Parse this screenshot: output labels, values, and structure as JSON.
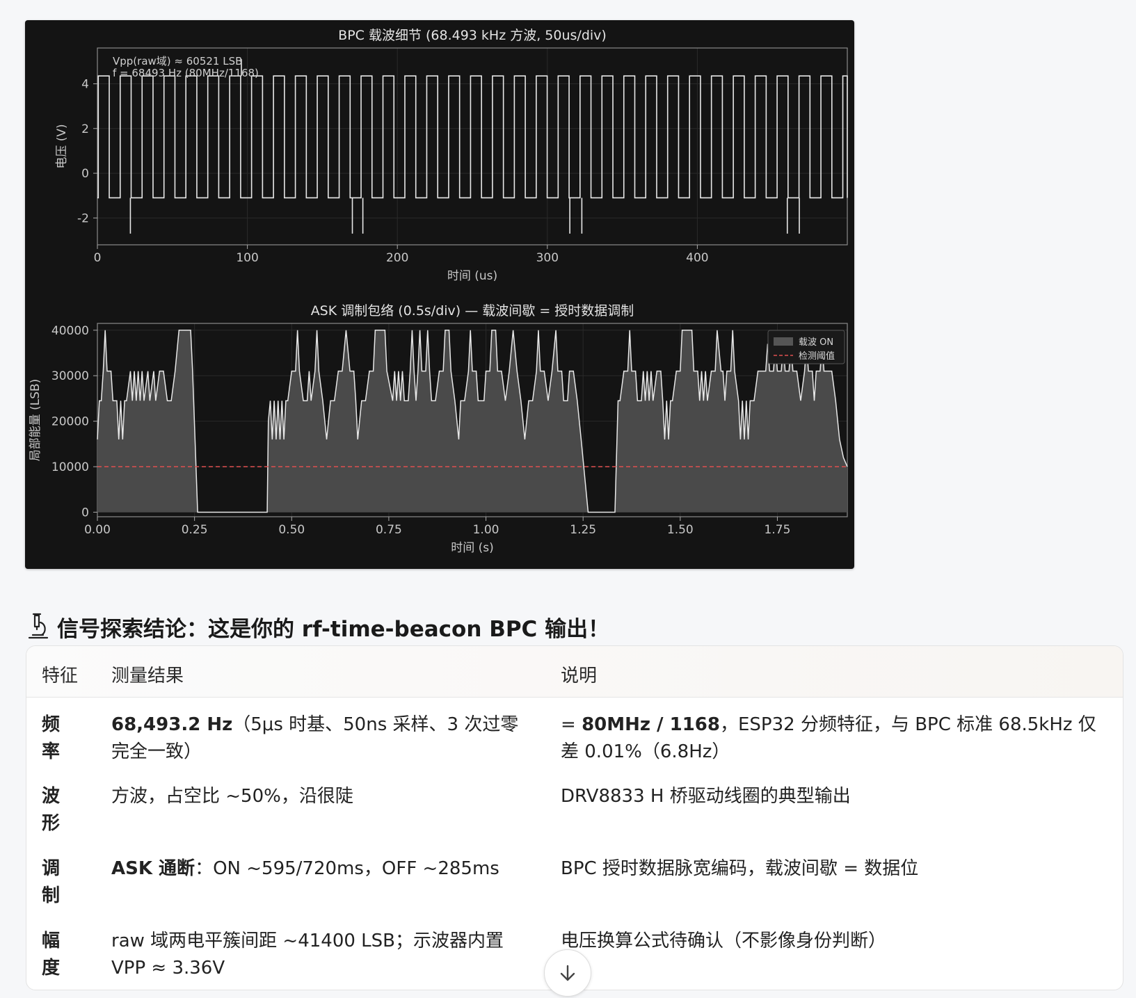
{
  "chart_data": [
    {
      "type": "line",
      "title": "BPC 载波细节 (68.493 kHz 方波, 50us/div)",
      "xlabel": "时间 (us)",
      "ylabel": "电压 (V)",
      "xlim": [
        0,
        500
      ],
      "ylim": [
        -3.2,
        5.6
      ],
      "xticks": [
        "0",
        "100",
        "200",
        "300",
        "400"
      ],
      "yticks": [
        "-2",
        "0",
        "2",
        "4"
      ],
      "grid": true,
      "annotation_lines": [
        "Vpp(raw域) ≈ 60521 LSB",
        "f = 68493 Hz (80MHz/1168)"
      ],
      "carrier": {
        "frequency_hz": 68493,
        "high_v": 4.35,
        "low_v": -1.1,
        "glitches_us": [
          22,
          170,
          177,
          315,
          323,
          460,
          468
        ],
        "glitch_low_v": -2.7,
        "glitch_high_v": 5.1,
        "glitch_high_us": [
          96
        ]
      }
    },
    {
      "type": "area",
      "title": "ASK 调制包络 (0.5s/div) — 载波间歇 = 授时数据调制",
      "xlabel": "时间 (s)",
      "ylabel": "局部能量 (LSB)",
      "xlim": [
        0,
        1.93
      ],
      "ylim": [
        -1000,
        41500
      ],
      "xticks": [
        "0.00",
        "0.25",
        "0.50",
        "0.75",
        "1.00",
        "1.25",
        "1.50",
        "1.75"
      ],
      "yticks": [
        "0",
        "10000",
        "20000",
        "30000",
        "40000"
      ],
      "grid": true,
      "legend": "top-right",
      "threshold": 10000,
      "series": [
        {
          "name": "载波 ON"
        },
        {
          "name": "检测阈值"
        }
      ],
      "on_segments": [
        [
          0.0,
          0.258
        ],
        [
          0.437,
          1.263
        ],
        [
          1.332,
          1.93
        ]
      ],
      "peaks_40k": [
        [
          0.21,
          0.245
        ],
        [
          0.45,
          0.49
        ],
        [
          0.57,
          0.61
        ],
        [
          0.78,
          0.82
        ],
        [
          1.02,
          1.06
        ],
        [
          1.25,
          1.26
        ],
        [
          1.5,
          1.54
        ],
        [
          1.62,
          1.64
        ],
        [
          1.76,
          1.8
        ]
      ],
      "envelope": [
        [
          0.0,
          16000
        ],
        [
          0.005,
          24500
        ],
        [
          0.01,
          24500
        ],
        [
          0.015,
          31000
        ],
        [
          0.02,
          40000
        ],
        [
          0.025,
          31000
        ],
        [
          0.035,
          31000
        ],
        [
          0.04,
          24500
        ],
        [
          0.05,
          24500
        ],
        [
          0.055,
          16000
        ],
        [
          0.06,
          24500
        ],
        [
          0.065,
          16000
        ],
        [
          0.07,
          24500
        ],
        [
          0.075,
          24500
        ],
        [
          0.085,
          31000
        ],
        [
          0.09,
          24500
        ],
        [
          0.095,
          31000
        ],
        [
          0.1,
          24500
        ],
        [
          0.105,
          31000
        ],
        [
          0.11,
          24500
        ],
        [
          0.115,
          31000
        ],
        [
          0.12,
          24500
        ],
        [
          0.13,
          31000
        ],
        [
          0.135,
          24500
        ],
        [
          0.145,
          31000
        ],
        [
          0.15,
          24500
        ],
        [
          0.16,
          31000
        ],
        [
          0.17,
          31000
        ],
        [
          0.18,
          24500
        ],
        [
          0.19,
          24500
        ],
        [
          0.2,
          31000
        ],
        [
          0.21,
          40000
        ],
        [
          0.24,
          40000
        ],
        [
          0.245,
          31000
        ],
        [
          0.258,
          0
        ],
        [
          0.437,
          0
        ],
        [
          0.44,
          20000
        ],
        [
          0.445,
          24500
        ],
        [
          0.45,
          16000
        ],
        [
          0.455,
          24500
        ],
        [
          0.46,
          16000
        ],
        [
          0.465,
          24500
        ],
        [
          0.47,
          16000
        ],
        [
          0.475,
          24500
        ],
        [
          0.48,
          16000
        ],
        [
          0.485,
          24500
        ],
        [
          0.49,
          24500
        ],
        [
          0.5,
          31000
        ],
        [
          0.51,
          31000
        ],
        [
          0.515,
          40000
        ],
        [
          0.52,
          31000
        ],
        [
          0.53,
          24500
        ],
        [
          0.54,
          24500
        ],
        [
          0.545,
          31000
        ],
        [
          0.55,
          24500
        ],
        [
          0.56,
          31000
        ],
        [
          0.565,
          40000
        ],
        [
          0.57,
          31000
        ],
        [
          0.58,
          24500
        ],
        [
          0.59,
          16000
        ],
        [
          0.6,
          24500
        ],
        [
          0.61,
          24500
        ],
        [
          0.62,
          31000
        ],
        [
          0.63,
          31000
        ],
        [
          0.64,
          40000
        ],
        [
          0.65,
          31000
        ],
        [
          0.66,
          31000
        ],
        [
          0.665,
          24500
        ],
        [
          0.67,
          16000
        ],
        [
          0.68,
          24500
        ],
        [
          0.69,
          24500
        ],
        [
          0.7,
          31000
        ],
        [
          0.71,
          31000
        ],
        [
          0.715,
          40000
        ],
        [
          0.74,
          40000
        ],
        [
          0.745,
          31000
        ],
        [
          0.76,
          24500
        ],
        [
          0.765,
          31000
        ],
        [
          0.77,
          24500
        ],
        [
          0.775,
          31000
        ],
        [
          0.78,
          24500
        ],
        [
          0.785,
          31000
        ],
        [
          0.79,
          24500
        ],
        [
          0.8,
          24500
        ],
        [
          0.805,
          31000
        ],
        [
          0.81,
          40000
        ],
        [
          0.815,
          31000
        ],
        [
          0.82,
          24500
        ],
        [
          0.825,
          31000
        ],
        [
          0.83,
          40000
        ],
        [
          0.835,
          31000
        ],
        [
          0.845,
          31000
        ],
        [
          0.85,
          40000
        ],
        [
          0.855,
          31000
        ],
        [
          0.86,
          24500
        ],
        [
          0.87,
          24500
        ],
        [
          0.88,
          31000
        ],
        [
          0.89,
          31000
        ],
        [
          0.895,
          40000
        ],
        [
          0.905,
          40000
        ],
        [
          0.91,
          31000
        ],
        [
          0.92,
          24500
        ],
        [
          0.93,
          16000
        ],
        [
          0.935,
          24500
        ],
        [
          0.945,
          24500
        ],
        [
          0.955,
          31000
        ],
        [
          0.96,
          40000
        ],
        [
          0.965,
          31000
        ],
        [
          0.975,
          31000
        ],
        [
          0.98,
          24500
        ],
        [
          0.995,
          24500
        ],
        [
          1.0,
          31000
        ],
        [
          1.01,
          31000
        ],
        [
          1.015,
          40000
        ],
        [
          1.025,
          40000
        ],
        [
          1.03,
          31000
        ],
        [
          1.04,
          31000
        ],
        [
          1.05,
          24500
        ],
        [
          1.06,
          31000
        ],
        [
          1.07,
          40000
        ],
        [
          1.08,
          31000
        ],
        [
          1.09,
          24500
        ],
        [
          1.1,
          16000
        ],
        [
          1.11,
          24500
        ],
        [
          1.12,
          24500
        ],
        [
          1.13,
          31000
        ],
        [
          1.135,
          40000
        ],
        [
          1.14,
          31000
        ],
        [
          1.15,
          31000
        ],
        [
          1.16,
          24500
        ],
        [
          1.17,
          31000
        ],
        [
          1.18,
          40000
        ],
        [
          1.185,
          31000
        ],
        [
          1.195,
          31000
        ],
        [
          1.2,
          24500
        ],
        [
          1.21,
          24500
        ],
        [
          1.215,
          31000
        ],
        [
          1.225,
          31000
        ],
        [
          1.235,
          24500
        ],
        [
          1.245,
          16000
        ],
        [
          1.263,
          0
        ],
        [
          1.332,
          0
        ],
        [
          1.34,
          24500
        ],
        [
          1.345,
          24500
        ],
        [
          1.355,
          31000
        ],
        [
          1.365,
          31000
        ],
        [
          1.37,
          40000
        ],
        [
          1.375,
          31000
        ],
        [
          1.385,
          31000
        ],
        [
          1.39,
          24500
        ],
        [
          1.4,
          24500
        ],
        [
          1.405,
          31000
        ],
        [
          1.41,
          24500
        ],
        [
          1.415,
          31000
        ],
        [
          1.42,
          24500
        ],
        [
          1.425,
          31000
        ],
        [
          1.43,
          24500
        ],
        [
          1.44,
          31000
        ],
        [
          1.45,
          31000
        ],
        [
          1.455,
          24500
        ],
        [
          1.46,
          16000
        ],
        [
          1.465,
          24500
        ],
        [
          1.47,
          16000
        ],
        [
          1.475,
          24500
        ],
        [
          1.48,
          24500
        ],
        [
          1.49,
          31000
        ],
        [
          1.5,
          31000
        ],
        [
          1.505,
          40000
        ],
        [
          1.53,
          40000
        ],
        [
          1.535,
          31000
        ],
        [
          1.545,
          31000
        ],
        [
          1.55,
          24500
        ],
        [
          1.555,
          31000
        ],
        [
          1.56,
          24500
        ],
        [
          1.565,
          31000
        ],
        [
          1.57,
          24500
        ],
        [
          1.58,
          31000
        ],
        [
          1.59,
          31000
        ],
        [
          1.595,
          40000
        ],
        [
          1.605,
          31000
        ],
        [
          1.61,
          31000
        ],
        [
          1.615,
          24500
        ],
        [
          1.62,
          31000
        ],
        [
          1.63,
          31000
        ],
        [
          1.635,
          40000
        ],
        [
          1.64,
          31000
        ],
        [
          1.65,
          24500
        ],
        [
          1.655,
          16000
        ],
        [
          1.66,
          24500
        ],
        [
          1.665,
          16000
        ],
        [
          1.67,
          24500
        ],
        [
          1.675,
          16000
        ],
        [
          1.68,
          24500
        ],
        [
          1.69,
          24500
        ],
        [
          1.7,
          31000
        ],
        [
          1.72,
          31000
        ],
        [
          1.725,
          37000
        ],
        [
          1.73,
          31000
        ],
        [
          1.74,
          31000
        ],
        [
          1.745,
          37000
        ],
        [
          1.75,
          31000
        ],
        [
          1.76,
          31000
        ],
        [
          1.765,
          37000
        ],
        [
          1.77,
          31000
        ],
        [
          1.78,
          31000
        ],
        [
          1.785,
          37000
        ],
        [
          1.79,
          31000
        ],
        [
          1.8,
          31000
        ],
        [
          1.81,
          24500
        ],
        [
          1.82,
          31000
        ],
        [
          1.825,
          37000
        ],
        [
          1.83,
          31000
        ],
        [
          1.84,
          31000
        ],
        [
          1.845,
          24500
        ],
        [
          1.85,
          31000
        ],
        [
          1.86,
          31000
        ],
        [
          1.865,
          37000
        ],
        [
          1.87,
          31000
        ],
        [
          1.88,
          31000
        ],
        [
          1.89,
          31000
        ],
        [
          1.9,
          24500
        ],
        [
          1.91,
          16000
        ],
        [
          1.92,
          12000
        ],
        [
          1.93,
          10000
        ]
      ]
    }
  ],
  "section": {
    "icon": "microscope-icon",
    "title": "信号探索结论：这是你的 rf-time-beacon BPC 输出！"
  },
  "table": {
    "headers": [
      "特征",
      "测量结果",
      "说明"
    ],
    "rows": [
      {
        "key": "频率",
        "measure_bold": "68,493.2 Hz",
        "measure_rest": "（5μs 时基、50ns 采样、3 次过零完全一致）",
        "desc_prefix": "= ",
        "desc_bold": "80MHz / 1168",
        "desc_rest": "，ESP32 分频特征，与 BPC 标准 68.5kHz 仅差 0.01%（6.8Hz）"
      },
      {
        "key": "波形",
        "measure_bold": "",
        "measure_rest": "方波，占空比 ~50%，沿很陡",
        "desc_prefix": "",
        "desc_bold": "",
        "desc_rest": "DRV8833 H 桥驱动线圈的典型输出"
      },
      {
        "key": "调制",
        "measure_bold": "ASK 通断",
        "measure_rest": "：ON ~595/720ms，OFF ~285ms",
        "desc_prefix": "",
        "desc_bold": "",
        "desc_rest": "BPC 授时数据脉宽编码，载波间歇 = 数据位"
      },
      {
        "key": "幅度",
        "measure_bold": "",
        "measure_rest": "raw 域两电平簇间距 ~41400 LSB；示波器内置 VPP ≈ 3.36V",
        "desc_prefix": "",
        "desc_bold": "",
        "desc_rest": "电压换算公式待确认（不影像身份判断）"
      }
    ]
  },
  "scroll_button": {
    "icon": "arrow-down-icon"
  },
  "colors": {
    "figure_bg": "#141414",
    "trace": "#e8e8e8",
    "area_fill": "#4a4a4a",
    "threshold": "#e05050",
    "axis_text": "#c8c8c8"
  }
}
